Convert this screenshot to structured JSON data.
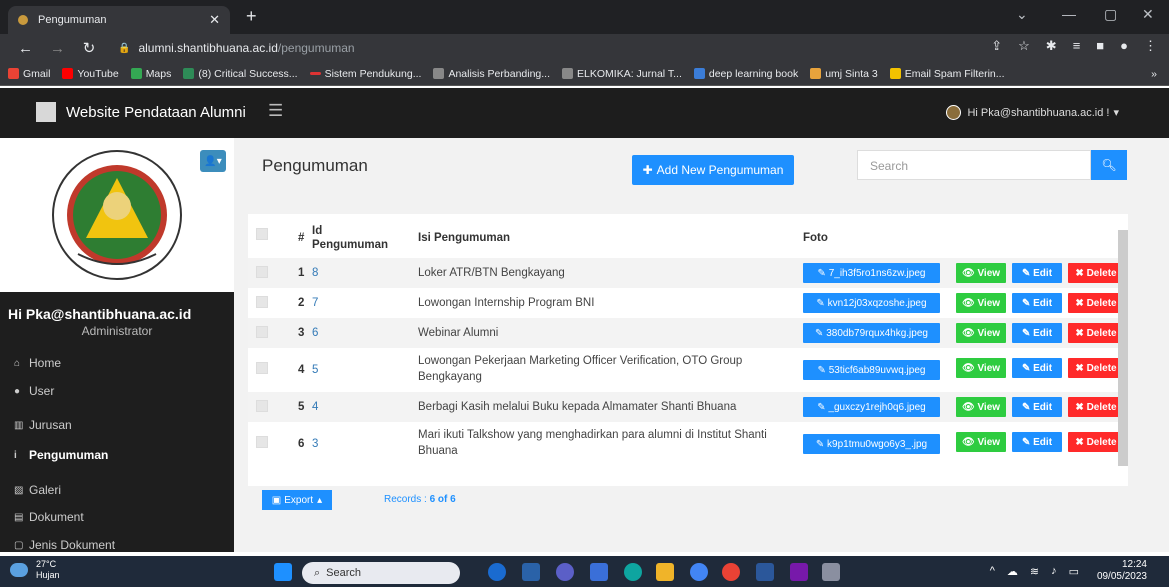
{
  "browser": {
    "tab_title": "Pengumuman",
    "url_host": "alumni.shantibhuana.ac.id",
    "url_path": "/pengumuman",
    "bookmarks": [
      "Gmail",
      "YouTube",
      "Maps",
      "(8) Critical Success...",
      "Sistem Pendukung...",
      "Analisis Perbanding...",
      "ELKOMIKA: Jurnal T...",
      "deep learning book",
      "umj Sinta 3",
      "Email Spam Filterin..."
    ]
  },
  "header": {
    "brand": "Website Pendataan Alumni",
    "user_menu": "Hi Pka@shantibhuana.ac.id !"
  },
  "sidebar": {
    "username": "Hi Pka@shantibhuana.ac.id",
    "role": "Administrator",
    "items": [
      {
        "label": "Home",
        "icon": "home-icon"
      },
      {
        "label": "User",
        "icon": "user-icon"
      },
      {
        "label": "Jurusan",
        "icon": "institution-icon"
      },
      {
        "label": "Pengumuman",
        "icon": "info-icon"
      },
      {
        "label": "Galeri",
        "icon": "image-icon"
      },
      {
        "label": "Dokument",
        "icon": "document-icon"
      },
      {
        "label": "Jenis Dokument",
        "icon": "file-icon"
      }
    ],
    "active": "Pengumuman"
  },
  "page": {
    "title": "Pengumuman",
    "add_button": "Add New Pengumuman",
    "search_placeholder": "Search"
  },
  "table": {
    "headers": {
      "hash": "#",
      "id_line1": "Id",
      "id_line2": "Pengumuman",
      "isi": "Isi Pengumuman",
      "foto": "Foto"
    },
    "rows": [
      {
        "no": "1",
        "id": "8",
        "isi": "Loker ATR/BTN Bengkayang",
        "foto": "7_ih3f5ro1ns6zw.jpeg"
      },
      {
        "no": "2",
        "id": "7",
        "isi": "Lowongan Internship Program BNI",
        "foto": "kvn12j03xqzoshe.jpeg"
      },
      {
        "no": "3",
        "id": "6",
        "isi": "Webinar Alumni",
        "foto": "380db79rqux4hkg.jpeg"
      },
      {
        "no": "4",
        "id": "5",
        "isi": "Lowongan Pekerjaan Marketing Officer Verification, OTO Group Bengkayang",
        "foto": "53ticf6ab89uvwq.jpeg"
      },
      {
        "no": "5",
        "id": "4",
        "isi": "Berbagi Kasih melalui Buku kepada Almamater Shanti Bhuana",
        "foto": "_guxczy1rejh0q6.jpeg"
      },
      {
        "no": "6",
        "id": "3",
        "isi": "Mari ikuti Talkshow yang menghadirkan para alumni di Institut Shanti Bhuana",
        "foto": "k9p1tmu0wgo6y3_.jpg"
      }
    ],
    "actions": {
      "view": "View",
      "edit": "Edit",
      "delete": "Delete"
    }
  },
  "footer": {
    "export": "Export",
    "records_label": "Records :",
    "records_value": "6 of 6"
  },
  "taskbar": {
    "temp": "27°C",
    "weather": "Hujan",
    "search": "Search",
    "time": "12:24",
    "date": "09/05/2023"
  },
  "colors": {
    "accent": "#1e90ff",
    "view": "#2ecc40",
    "delete": "#ff2a2a",
    "sidebar": "#1e1e1e"
  }
}
